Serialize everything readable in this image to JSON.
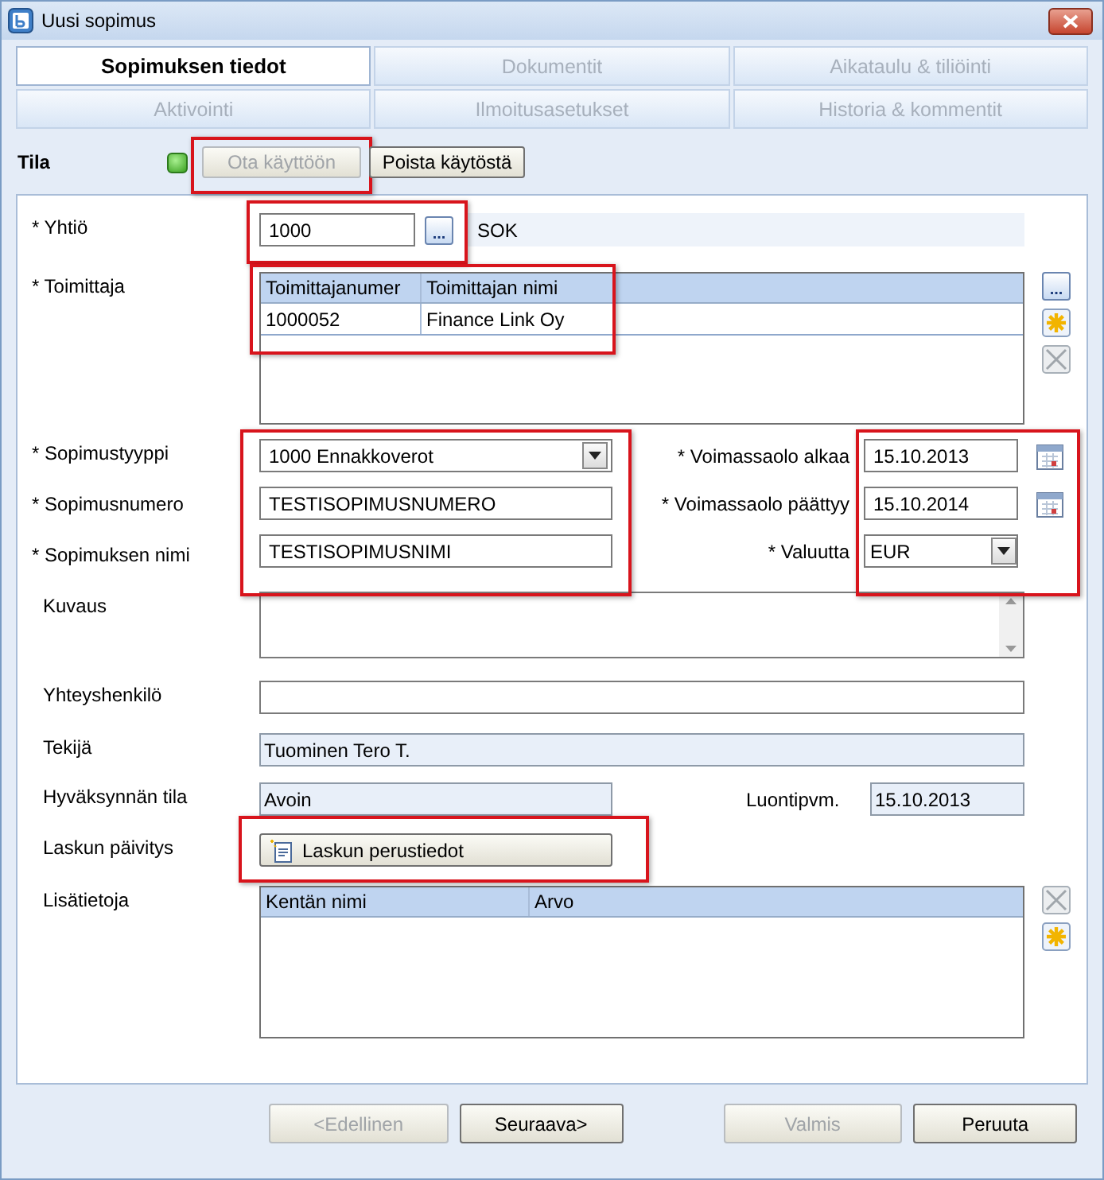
{
  "window": {
    "title": "Uusi sopimus"
  },
  "tabs": [
    {
      "label": "Sopimuksen tiedot",
      "selected": true
    },
    {
      "label": "Dokumentit",
      "selected": false
    },
    {
      "label": "Aikataulu & tiliöinti",
      "selected": false
    },
    {
      "label": "Aktivointi",
      "selected": false
    },
    {
      "label": "Ilmoitusasetukset",
      "selected": false
    },
    {
      "label": "Historia & kommentit",
      "selected": false
    }
  ],
  "status": {
    "label": "Tila",
    "buttons": [
      {
        "label": "Ota käyttöön",
        "disabled": true,
        "highlighted": true
      },
      {
        "label": "Poista käytöstä",
        "disabled": false,
        "highlighted": false
      }
    ]
  },
  "company": {
    "label": "* Yhtiö",
    "value": "1000",
    "browse_label": "...",
    "name": "SOK",
    "highlighted": true
  },
  "supplier": {
    "label": "* Toimittaja",
    "columns": [
      "Toimittajanumer",
      "Toimittajan nimi"
    ],
    "rows": [
      [
        "1000052",
        "Finance Link Oy"
      ]
    ],
    "browse_label": "...",
    "highlighted": true
  },
  "contract_left": {
    "highlighted": true,
    "fields": [
      {
        "kind": "dropdown",
        "label": "* Sopimustyyppi",
        "value": "1000 Ennakkoverot"
      },
      {
        "kind": "text",
        "label": "* Sopimusnumero",
        "value": "TESTISOPIMUSNUMERO"
      },
      {
        "kind": "text",
        "label": "* Sopimuksen nimi",
        "value": "TESTISOPIMUSNIMI"
      }
    ]
  },
  "contract_right": {
    "highlighted": true,
    "fields": [
      {
        "kind": "date",
        "label": "* Voimassaolo alkaa",
        "value": "15.10.2013"
      },
      {
        "kind": "date",
        "label": "* Voimassaolo päättyy",
        "value": "15.10.2014"
      },
      {
        "kind": "dropdown",
        "label": "* Valuutta",
        "value": "EUR"
      }
    ]
  },
  "description": {
    "label": "Kuvaus"
  },
  "contact": {
    "label": "Yhteyshenkilö"
  },
  "author": {
    "label": "Tekijä",
    "value": "Tuominen Tero T."
  },
  "approval": {
    "label": "Hyväksynnän tila",
    "value": "Avoin"
  },
  "created": {
    "label": "Luontipvm.",
    "value": "15.10.2013"
  },
  "invoice_update": {
    "label": "Laskun päivitys",
    "button": "Laskun perustiedot",
    "highlighted": true
  },
  "extra_info": {
    "label": "Lisätietoja",
    "columns": [
      "Kentän nimi",
      "Arvo"
    ]
  },
  "footer_buttons": [
    {
      "label": "<Edellinen",
      "disabled": true
    },
    {
      "label": "Seuraava>",
      "disabled": false
    },
    {
      "label": "Valmis",
      "disabled": true
    },
    {
      "label": "Peruuta",
      "disabled": false
    }
  ]
}
